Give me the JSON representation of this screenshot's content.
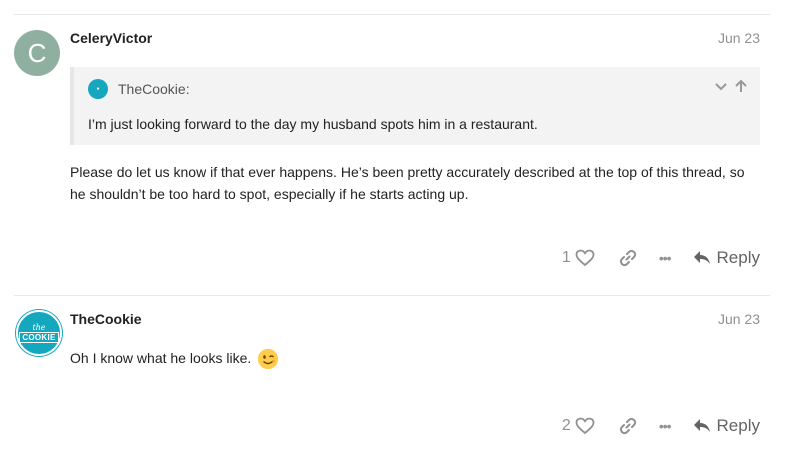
{
  "posts": [
    {
      "avatar_letter": "C",
      "username": "CeleryVictor",
      "date": "Jun 23",
      "quote": {
        "username": "TheCookie:",
        "text": "I’m just looking forward to the day my husband spots him in a restaurant."
      },
      "body": "Please do let us know if that ever happens. He’s been pretty accurately described at the top of this thread, so he shouldn’t be too hard to spot, especially if he starts acting up.",
      "likes": "1",
      "reply_label": "Reply"
    },
    {
      "avatar_text_small": "the",
      "avatar_text": "COOKIE",
      "username": "TheCookie",
      "date": "Jun 23",
      "body": "Oh I know what he looks like.",
      "emoji": "winking-face-emoji",
      "likes": "2",
      "reply_label": "Reply"
    }
  ],
  "colors": {
    "avatar_celery": "#8fb0a0",
    "avatar_cookie": "#15a7be",
    "muted": "#919191"
  }
}
